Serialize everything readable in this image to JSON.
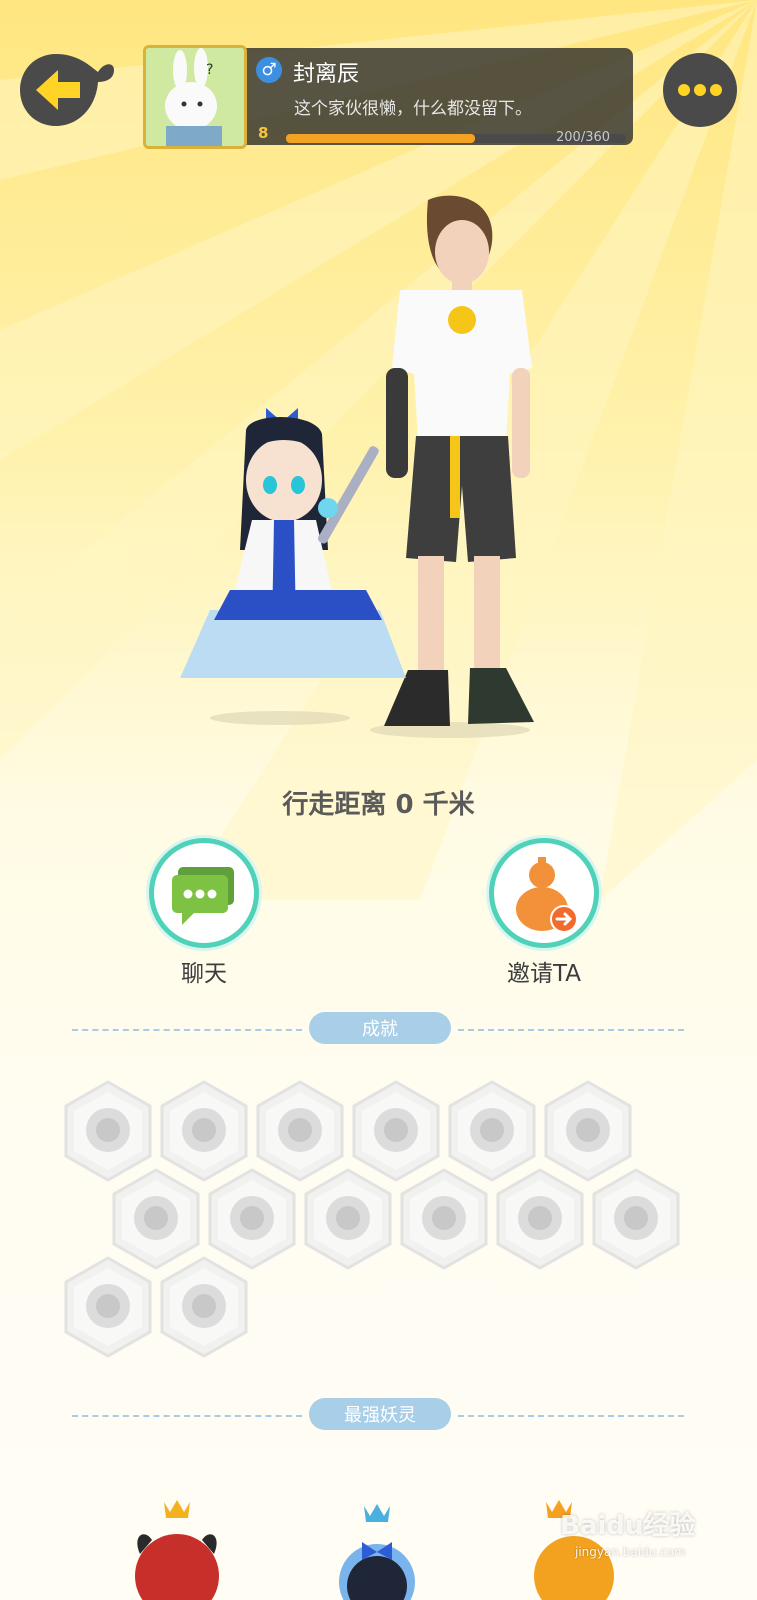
{
  "header": {
    "name": "封离辰",
    "gender_symbol": "♂",
    "motto": "这个家伙很懒，什么都没留下。",
    "level": "8",
    "xp_text": "200/360",
    "xp_progress": 0.556
  },
  "distance_text": "行走距离 0 千米",
  "actions": {
    "chat_label": "聊天",
    "invite_label": "邀请TA"
  },
  "sections": {
    "achievements_title": "成就",
    "strongest_title": "最强妖灵"
  },
  "achievement_icons": [
    "sneaker-icon",
    "lollipop-icon",
    "devil-cat-icon",
    "moon-icon",
    "ball-icon",
    "crystal-icon",
    "yin-yang-wave-icon",
    "monkey-icon",
    "cat-cart-icon",
    "bear-balloon-icon",
    "taiji-box-icon",
    "dragon-icon",
    "scroll-icon",
    "open-book-icon"
  ],
  "watermark": {
    "brand": "Baidu经验",
    "url": "jingyan.baidu.com"
  },
  "colors": {
    "accent": "#4fd2b8",
    "section_pill": "#a9cfe8",
    "xp_fill": "#f2a324"
  }
}
